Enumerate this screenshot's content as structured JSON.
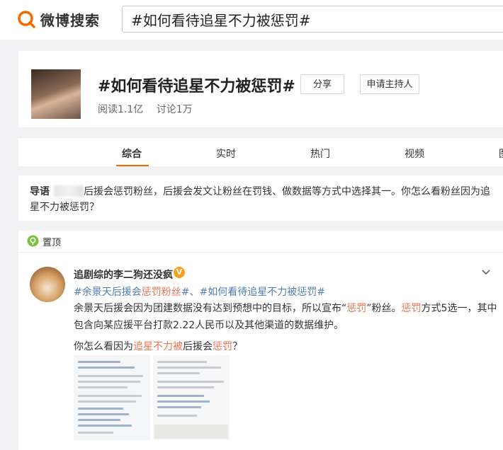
{
  "header": {
    "logo_text": "微博搜索",
    "search_value": "#如何看待追星不力被惩罚#"
  },
  "topic": {
    "title": "#如何看待追星不力被惩罚#",
    "reads": "阅读1.1亿",
    "discussions": "讨论1万",
    "share_label": "分享",
    "host_label": "申请主持人"
  },
  "tabs": [
    {
      "label": "综合"
    },
    {
      "label": "实时"
    },
    {
      "label": "热门"
    },
    {
      "label": "视频"
    },
    {
      "label": "图"
    }
  ],
  "guide": {
    "label": "导语",
    "text": "后援会惩罚粉丝，后援会发文让粉丝在罚钱、做数据等方式中选择其一。你怎么看粉丝因为追星不力被惩罚？"
  },
  "post": {
    "pin_label": "置顶",
    "author": "追剧综的李二狗还没疯",
    "verified_icon": "vip-badge-icon",
    "hashtag_1a": "#余景天后援会",
    "hashtag_1b": "惩罚粉丝",
    "hashtag_1c": "#、",
    "hashtag_2": "#如何看待追星不力被惩罚#",
    "body_p1_a": "余景天后援会因为团建数据没有达到预想中的目标，所以宣布“",
    "body_p1_b": "惩罚",
    "body_p1_c": "”粉丝。",
    "body_p1_d": "惩罚",
    "body_p1_e": "方式5选一，其中包含向某应援平台打款2.22人民币以及其他渠道的数据维护。",
    "body_p2_a": "你怎么看因为",
    "body_p2_b": "追星不力被",
    "body_p2_c": "后援会",
    "body_p2_d": "惩罚",
    "body_p2_e": "？"
  },
  "colors": {
    "accent": "#f56a00",
    "highlight": "#eb7350",
    "link": "#507daf",
    "badge": "#f7a11a"
  }
}
